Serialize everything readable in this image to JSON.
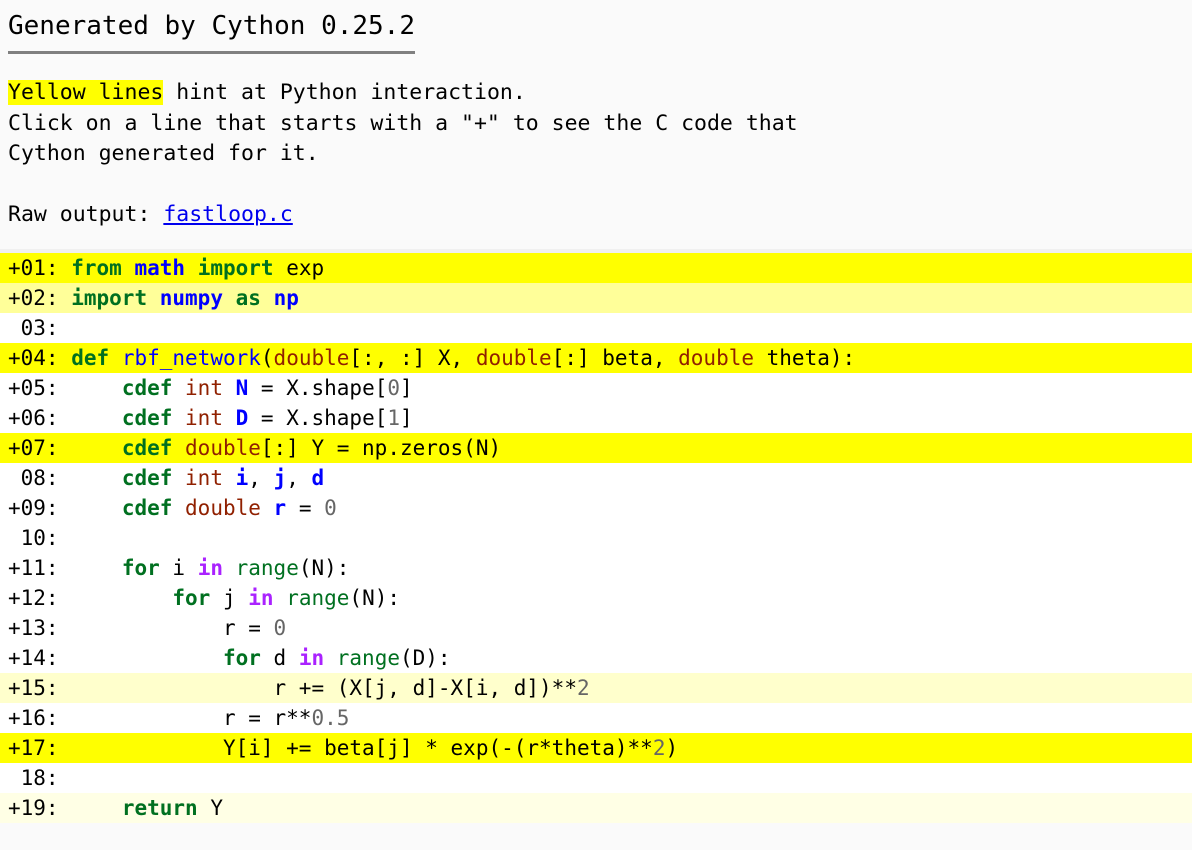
{
  "header": {
    "title": "Generated by Cython 0.25.2",
    "hint_highlight": "Yellow lines",
    "hint_rest": " hint at Python interaction.\nClick on a line that starts with a \"+\" to see the C code that\nCython generated for it.",
    "raw_label": "Raw output: ",
    "raw_link": "fastloop.c"
  },
  "colors": {
    "highlight_bright": "#FFFF00",
    "highlight_mid": "#FFFF99",
    "highlight_light": "#FFFFCC",
    "highlight_faint": "#FFFFE5",
    "plain": "#FFFFFF",
    "keyword": "#007020",
    "type": "#902000",
    "name": "#0000FF",
    "operator_word": "#AA22FF",
    "number": "#666666",
    "link": "#0000EE",
    "rule": "#808080"
  },
  "code": {
    "lines": [
      {
        "num": "+01:",
        "clickable": true,
        "score": 8,
        "tokens": [
          {
            "t": "from ",
            "c": "k"
          },
          {
            "t": "math",
            "c": "nn"
          },
          {
            "t": " ",
            "c": "p"
          },
          {
            "t": "import ",
            "c": "k"
          },
          {
            "t": "exp",
            "c": "n"
          }
        ]
      },
      {
        "num": "+02:",
        "clickable": true,
        "score": 3,
        "tokens": [
          {
            "t": "import ",
            "c": "k"
          },
          {
            "t": "numpy",
            "c": "nn"
          },
          {
            "t": " ",
            "c": "p"
          },
          {
            "t": "as ",
            "c": "k"
          },
          {
            "t": "np",
            "c": "nn"
          }
        ]
      },
      {
        "num": " 03:",
        "clickable": false,
        "score": 0,
        "tokens": []
      },
      {
        "num": "+04:",
        "clickable": true,
        "score": 8,
        "tokens": [
          {
            "t": "def ",
            "c": "k"
          },
          {
            "t": "rbf_network",
            "c": "nf"
          },
          {
            "t": "(",
            "c": "p"
          },
          {
            "t": "double",
            "c": "kt"
          },
          {
            "t": "[:, :] X, ",
            "c": "p"
          },
          {
            "t": "double",
            "c": "kt"
          },
          {
            "t": "[:] beta, ",
            "c": "p"
          },
          {
            "t": "double",
            "c": "kt"
          },
          {
            "t": " theta):",
            "c": "p"
          }
        ]
      },
      {
        "num": "+05:",
        "clickable": true,
        "score": 0,
        "tokens": [
          {
            "t": "    ",
            "c": "p"
          },
          {
            "t": "cdef ",
            "c": "k"
          },
          {
            "t": "int",
            "c": "kt"
          },
          {
            "t": " ",
            "c": "p"
          },
          {
            "t": "N",
            "c": "nv"
          },
          {
            "t": " = X.shape[",
            "c": "p"
          },
          {
            "t": "0",
            "c": "mf"
          },
          {
            "t": "]",
            "c": "p"
          }
        ]
      },
      {
        "num": "+06:",
        "clickable": true,
        "score": 0,
        "tokens": [
          {
            "t": "    ",
            "c": "p"
          },
          {
            "t": "cdef ",
            "c": "k"
          },
          {
            "t": "int",
            "c": "kt"
          },
          {
            "t": " ",
            "c": "p"
          },
          {
            "t": "D",
            "c": "nv"
          },
          {
            "t": " = X.shape[",
            "c": "p"
          },
          {
            "t": "1",
            "c": "mf"
          },
          {
            "t": "]",
            "c": "p"
          }
        ]
      },
      {
        "num": "+07:",
        "clickable": true,
        "score": 8,
        "tokens": [
          {
            "t": "    ",
            "c": "p"
          },
          {
            "t": "cdef ",
            "c": "k"
          },
          {
            "t": "double",
            "c": "kt"
          },
          {
            "t": "[:] Y = np.zeros(N)",
            "c": "p"
          }
        ]
      },
      {
        "num": " 08:",
        "clickable": false,
        "score": 0,
        "tokens": [
          {
            "t": "    ",
            "c": "p"
          },
          {
            "t": "cdef ",
            "c": "k"
          },
          {
            "t": "int",
            "c": "kt"
          },
          {
            "t": " ",
            "c": "p"
          },
          {
            "t": "i",
            "c": "nv"
          },
          {
            "t": ", ",
            "c": "p"
          },
          {
            "t": "j",
            "c": "nv"
          },
          {
            "t": ", ",
            "c": "p"
          },
          {
            "t": "d",
            "c": "nv"
          }
        ]
      },
      {
        "num": "+09:",
        "clickable": true,
        "score": 0,
        "tokens": [
          {
            "t": "    ",
            "c": "p"
          },
          {
            "t": "cdef ",
            "c": "k"
          },
          {
            "t": "double",
            "c": "kt"
          },
          {
            "t": " ",
            "c": "p"
          },
          {
            "t": "r",
            "c": "nv"
          },
          {
            "t": " = ",
            "c": "p"
          },
          {
            "t": "0",
            "c": "mf"
          }
        ]
      },
      {
        "num": " 10:",
        "clickable": false,
        "score": 0,
        "tokens": []
      },
      {
        "num": "+11:",
        "clickable": true,
        "score": 0,
        "tokens": [
          {
            "t": "    ",
            "c": "p"
          },
          {
            "t": "for ",
            "c": "k"
          },
          {
            "t": "i ",
            "c": "n"
          },
          {
            "t": "in ",
            "c": "ow"
          },
          {
            "t": "range",
            "c": "nb"
          },
          {
            "t": "(N):",
            "c": "p"
          }
        ]
      },
      {
        "num": "+12:",
        "clickable": true,
        "score": 0,
        "tokens": [
          {
            "t": "        ",
            "c": "p"
          },
          {
            "t": "for ",
            "c": "k"
          },
          {
            "t": "j ",
            "c": "n"
          },
          {
            "t": "in ",
            "c": "ow"
          },
          {
            "t": "range",
            "c": "nb"
          },
          {
            "t": "(N):",
            "c": "p"
          }
        ]
      },
      {
        "num": "+13:",
        "clickable": true,
        "score": 0,
        "tokens": [
          {
            "t": "            r = ",
            "c": "p"
          },
          {
            "t": "0",
            "c": "mf"
          }
        ]
      },
      {
        "num": "+14:",
        "clickable": true,
        "score": 0,
        "tokens": [
          {
            "t": "            ",
            "c": "p"
          },
          {
            "t": "for ",
            "c": "k"
          },
          {
            "t": "d ",
            "c": "n"
          },
          {
            "t": "in ",
            "c": "ow"
          },
          {
            "t": "range",
            "c": "nb"
          },
          {
            "t": "(D):",
            "c": "p"
          }
        ]
      },
      {
        "num": "+15:",
        "clickable": true,
        "score": 2,
        "tokens": [
          {
            "t": "                r += (X[j, d]-X[i, d])**",
            "c": "p"
          },
          {
            "t": "2",
            "c": "mf"
          }
        ]
      },
      {
        "num": "+16:",
        "clickable": true,
        "score": 0,
        "tokens": [
          {
            "t": "            r = r**",
            "c": "p"
          },
          {
            "t": "0.5",
            "c": "mf"
          }
        ]
      },
      {
        "num": "+17:",
        "clickable": true,
        "score": 8,
        "tokens": [
          {
            "t": "            Y[i] += beta[j] * exp(-(r*theta)**",
            "c": "p"
          },
          {
            "t": "2",
            "c": "mf"
          },
          {
            "t": ")",
            "c": "p"
          }
        ]
      },
      {
        "num": " 18:",
        "clickable": false,
        "score": 0,
        "tokens": []
      },
      {
        "num": "+19:",
        "clickable": true,
        "score": 1,
        "tokens": [
          {
            "t": "    ",
            "c": "p"
          },
          {
            "t": "return ",
            "c": "k"
          },
          {
            "t": "Y",
            "c": "n"
          }
        ]
      }
    ]
  }
}
